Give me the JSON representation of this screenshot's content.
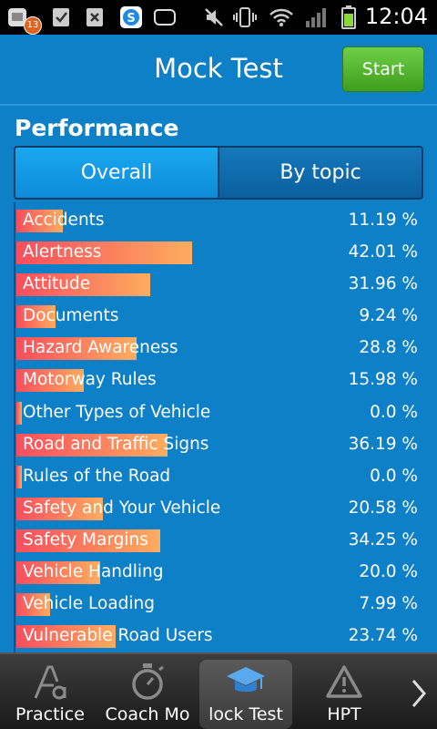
{
  "status_bar": {
    "time": "12:04",
    "notification_count": "13",
    "icons": [
      "app-notification-icon",
      "checkbox-icon",
      "close-box-icon",
      "skype-icon",
      "cloud-icon",
      "mute-icon",
      "vibrate-icon",
      "wifi-icon",
      "signal-icon",
      "battery-icon"
    ]
  },
  "header": {
    "title": "Mock Test",
    "start_label": "Start"
  },
  "performance": {
    "heading": "Performance",
    "tabs": [
      {
        "label": "Overall",
        "selected": true
      },
      {
        "label": "By topic",
        "selected": false
      }
    ],
    "items": [
      {
        "label": "Accidents",
        "value": "11.19 %",
        "percent": 11.19
      },
      {
        "label": "Alertness",
        "value": "42.01 %",
        "percent": 42.01
      },
      {
        "label": "Attitude",
        "value": "31.96 %",
        "percent": 31.96
      },
      {
        "label": "Documents",
        "value": "9.24 %",
        "percent": 9.24
      },
      {
        "label": "Hazard Awareness",
        "value": "28.8 %",
        "percent": 28.8
      },
      {
        "label": "Motorway Rules",
        "value": "15.98 %",
        "percent": 15.98
      },
      {
        "label": "Other Types of Vehicle",
        "value": "0.0 %",
        "percent": 0.0
      },
      {
        "label": "Road and Traffic Signs",
        "value": "36.19 %",
        "percent": 36.19
      },
      {
        "label": "Rules of the Road",
        "value": "0.0 %",
        "percent": 0.0
      },
      {
        "label": "Safety and Your Vehicle",
        "value": "20.58 %",
        "percent": 20.58
      },
      {
        "label": "Safety Margins",
        "value": "34.25 %",
        "percent": 34.25
      },
      {
        "label": "Vehicle Handling",
        "value": "20.0 %",
        "percent": 20.0
      },
      {
        "label": "Vehicle Loading",
        "value": "7.99 %",
        "percent": 7.99
      },
      {
        "label": "Vulnerable Road Users",
        "value": "23.74 %",
        "percent": 23.74
      }
    ]
  },
  "bottom_nav": {
    "tabs": [
      {
        "label": "Practice",
        "icon": "practice-icon",
        "selected": false
      },
      {
        "label": "Coach Mo",
        "icon": "stopwatch-icon",
        "selected": false
      },
      {
        "label": "lock Test",
        "icon": "graduation-cap-icon",
        "selected": true
      },
      {
        "label": "HPT",
        "icon": "warning-triangle-icon",
        "selected": false
      }
    ],
    "next_icon": "chevron-right-icon"
  },
  "colors": {
    "background": "#0e80c8",
    "bar_start": "#f94d5d",
    "bar_end": "#fdad5f",
    "start_button": "#4caf28"
  }
}
